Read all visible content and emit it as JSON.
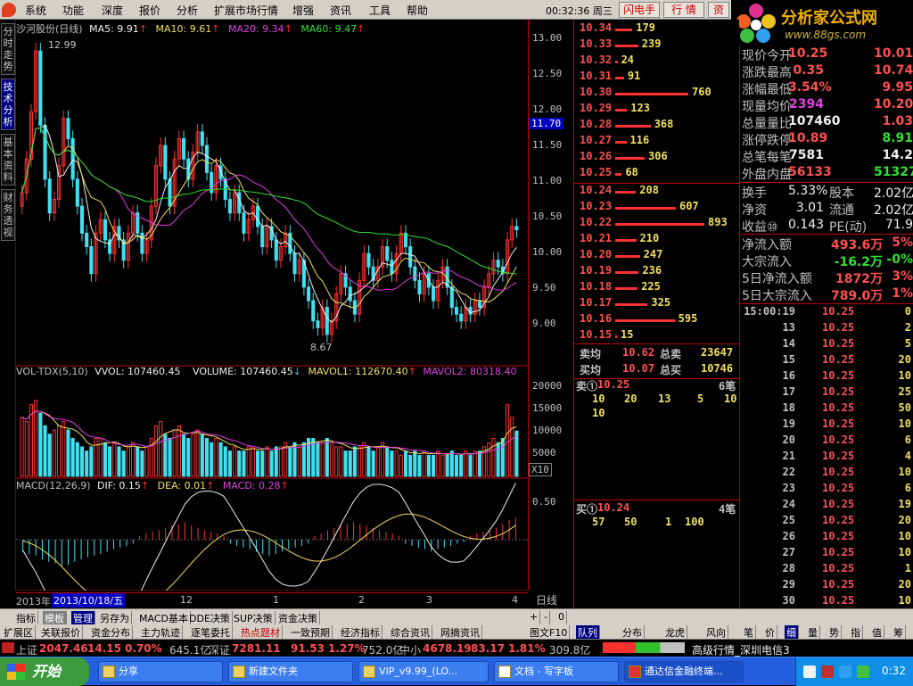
{
  "menu": {
    "items": [
      "系统",
      "功能",
      "深度",
      "报价",
      "分析",
      "扩展市场行情",
      "增强",
      "资讯",
      "工具",
      "帮助"
    ],
    "clock": "00:32:36 周三",
    "buttons": [
      "闪电手",
      "行 情",
      "资"
    ]
  },
  "brand": {
    "title": "分析家公式网",
    "url": "www.88gs.com"
  },
  "left_tabs": [
    "分时走势",
    "技术分析",
    "基本资料",
    "财务透视"
  ],
  "chart": {
    "header": {
      "name": "沙河股份(日线)",
      "ma5": "MA5: 9.91",
      "ma10": "MA10: 9.61",
      "ma20": "MA20: 9.34",
      "ma60": "MA60: 9.47"
    },
    "price_axis": [
      "13.00",
      "12.50",
      "12.00",
      "11.50",
      "11.00",
      "10.50",
      "10.00",
      "9.50",
      "9.00"
    ],
    "price_tag": "11.70",
    "high_label": "12.99",
    "low_label": "8.67",
    "vol_header": {
      "name": "VOL-TDX(5,10)",
      "vvol": "VVOL: 107460.45",
      "volume": "VOLUME: 107460.45",
      "mavol1": "MAVOL1: 112670.40",
      "mavol2": "MAVOL2: 80318.40"
    },
    "vol_axis": [
      "20000",
      "15000",
      "10000",
      "5000"
    ],
    "vol_unit": "X10",
    "macd_header": {
      "name": "MACD(12,26,9)",
      "dif": "DIF: 0.15",
      "dea": "DEA: 0.01",
      "macd": "MACD: 0.28"
    },
    "macd_axis": [
      "0.50"
    ],
    "date_axis": {
      "year": "2013年",
      "date": "2013/10/18/五",
      "ticks": [
        "12",
        "1",
        "2",
        "3",
        "4"
      ]
    },
    "period": "日线",
    "chart_data": {
      "type": "candlestick",
      "price_ylim": [
        8.5,
        13.1
      ],
      "macd_ylim": [
        -0.6,
        0.6
      ],
      "closes": [
        10.8,
        11.3,
        12.0,
        12.9,
        11.8,
        11.0,
        10.5,
        10.7,
        11.2,
        11.9,
        11.6,
        11.0,
        10.6,
        10.2,
        10.0,
        9.6,
        10.2,
        10.4,
        10.1,
        9.9,
        10.3,
        10.1,
        9.8,
        10.2,
        10.5,
        10.2,
        9.9,
        10.1,
        10.6,
        11.2,
        11.5,
        11.0,
        10.6,
        11.3,
        11.6,
        11.3,
        11.0,
        11.4,
        11.7,
        11.5,
        11.1,
        10.8,
        11.2,
        11.0,
        10.7,
        10.5,
        10.8,
        10.5,
        10.2,
        10.4,
        10.6,
        10.3,
        10.0,
        10.3,
        10.1,
        9.8,
        10.0,
        10.2,
        9.9,
        9.6,
        9.8,
        9.4,
        9.2,
        8.9,
        8.8,
        9.1,
        8.7,
        8.9,
        9.3,
        9.6,
        9.4,
        9.2,
        9.0,
        9.5,
        9.9,
        9.7,
        9.5,
        9.7,
        10.0,
        9.8,
        9.6,
        9.9,
        10.2,
        10.0,
        9.7,
        9.5,
        9.3,
        9.6,
        9.4,
        9.2,
        9.5,
        9.7,
        9.4,
        9.1,
        9.0,
        8.9,
        9.1,
        9.0,
        9.2,
        9.1,
        9.4,
        9.6,
        9.8,
        9.7,
        9.6,
        10.1,
        10.3,
        10.25
      ],
      "volumes": [
        14000,
        13000,
        17000,
        18000,
        15000,
        12000,
        10000,
        11000,
        12000,
        13000,
        11000,
        9000,
        8000,
        7000,
        6000,
        7000,
        9000,
        9000,
        8000,
        7000,
        8000,
        7000,
        6000,
        7000,
        8000,
        7000,
        6000,
        7000,
        9000,
        12000,
        13000,
        10000,
        9000,
        11000,
        12000,
        10000,
        9000,
        10000,
        11000,
        10000,
        9000,
        8000,
        9000,
        8000,
        7000,
        6000,
        7000,
        6000,
        6000,
        7000,
        7000,
        6000,
        6000,
        7000,
        6000,
        7000,
        7000,
        8000,
        7000,
        8000,
        7000,
        8000,
        9000,
        9000,
        8000,
        8000,
        9000,
        8000,
        7000,
        7000,
        6000,
        6000,
        7000,
        7000,
        8000,
        7000,
        6000,
        7000,
        8000,
        7000,
        6000,
        6000,
        5000,
        6000,
        5000,
        6000,
        5000,
        6000,
        5000,
        5000,
        6000,
        5000,
        5000,
        6000,
        5000,
        5000,
        6000,
        5000,
        6000,
        6000,
        7000,
        8000,
        9000,
        8000,
        9000,
        17000,
        14000,
        10746
      ],
      "macd_hist": [
        -0.15,
        -0.18,
        -0.2,
        -0.25,
        -0.28,
        -0.3,
        -0.35,
        -0.32,
        -0.28,
        -0.25,
        -0.22,
        -0.2,
        -0.18,
        -0.15,
        -0.12,
        -0.1,
        -0.08,
        -0.05,
        0.05,
        0.08,
        0.1,
        0.12,
        0.15,
        0.18,
        0.2,
        0.22,
        0.18,
        0.15,
        0.12,
        0.1,
        0.08,
        0.05,
        -0.05,
        -0.08,
        -0.1,
        -0.12,
        -0.15,
        -0.18,
        -0.2,
        -0.18,
        -0.15,
        -0.12,
        -0.1,
        -0.08,
        -0.05,
        0.05,
        0.08,
        0.12,
        0.15,
        0.18,
        0.2,
        0.22,
        0.2,
        0.18,
        0.15,
        0.12,
        0.1,
        0.08,
        0.05,
        -0.05,
        -0.08,
        -0.1,
        -0.12,
        -0.15,
        -0.12,
        -0.1,
        -0.08,
        -0.05,
        -0.03,
        0.05,
        0.08,
        0.1,
        0.12,
        0.15,
        0.2,
        0.25,
        0.28
      ]
    }
  },
  "orderbook": {
    "asks": [
      {
        "p": "10.34",
        "v": "179"
      },
      {
        "p": "10.33",
        "v": "239"
      },
      {
        "p": "10.32",
        "v": "24"
      },
      {
        "p": "10.31",
        "v": "91"
      },
      {
        "p": "10.30",
        "v": "760"
      },
      {
        "p": "10.29",
        "v": "123"
      },
      {
        "p": "10.28",
        "v": "368"
      },
      {
        "p": "10.27",
        "v": "116"
      },
      {
        "p": "10.26",
        "v": "306"
      },
      {
        "p": "10.25",
        "v": "68"
      }
    ],
    "bids": [
      {
        "p": "10.24",
        "v": "208"
      },
      {
        "p": "10.23",
        "v": "607"
      },
      {
        "p": "10.22",
        "v": "893"
      },
      {
        "p": "10.21",
        "v": "210"
      },
      {
        "p": "10.20",
        "v": "247"
      },
      {
        "p": "10.19",
        "v": "236"
      },
      {
        "p": "10.18",
        "v": "225"
      },
      {
        "p": "10.17",
        "v": "325"
      },
      {
        "p": "10.16",
        "v": "595"
      },
      {
        "p": "10.15",
        "v": "15"
      }
    ],
    "sell_avg_label": "卖均",
    "sell_avg": "10.62",
    "total_sell_label": "总卖",
    "total_sell": "23647",
    "buy_avg_label": "买均",
    "buy_avg": "10.07",
    "total_buy_label": "总买",
    "total_buy": "10746",
    "sell1_label": "卖①",
    "sell1_price": "10.25",
    "sell1_count": "6笔",
    "sell1_queue": [
      "10",
      "20",
      "13",
      "5",
      "10",
      "10"
    ],
    "buy1_label": "买①",
    "buy1_price": "10.24",
    "buy1_count": "4笔",
    "buy1_queue": [
      "57",
      "50",
      "1",
      "100"
    ]
  },
  "quote": {
    "rows": [
      {
        "l1": "现价",
        "v1": "10.25",
        "l2": "今开",
        "v2": "10.01",
        "c1": "#ff5050",
        "c2": "#ff5050"
      },
      {
        "l1": "涨跌",
        "v1": "0.35",
        "l2": "最高",
        "v2": "10.74",
        "c1": "#ff5050",
        "c2": "#ff5050"
      },
      {
        "l1": "涨幅",
        "v1": "3.54%",
        "l2": "最低",
        "v2": "9.95",
        "c1": "#ff5050",
        "c2": "#ff5050"
      },
      {
        "l1": "现量",
        "v1": "2394",
        "l2": "均价",
        "v2": "10.20",
        "c1": "#e040e0",
        "c2": "#ff5050"
      },
      {
        "l1": "总量",
        "v1": "107460",
        "l2": "量比",
        "v2": "1.03",
        "c1": "#f0f0f0",
        "c2": "#ff5050"
      },
      {
        "l1": "涨停",
        "v1": "10.89",
        "l2": "跌停",
        "v2": "8.91",
        "c1": "#ff5050",
        "c2": "#30e030"
      },
      {
        "l1": "总笔",
        "v1": "7581",
        "l2": "每笔",
        "v2": "14.2",
        "c1": "#f0f0f0",
        "c2": "#f0f0f0"
      },
      {
        "l1": "外盘",
        "v1": "56133",
        "l2": "内盘",
        "v2": "51327",
        "c1": "#ff5050",
        "c2": "#30e030"
      }
    ],
    "rows2": [
      {
        "l1": "换手",
        "v1": "5.33%",
        "l2": "股本",
        "v2": "2.02亿"
      },
      {
        "l1": "净资",
        "v1": "3.01",
        "l2": "流通",
        "v2": "2.02亿"
      },
      {
        "l1": "收益⑩",
        "v1": "0.143",
        "l2": "PE(动)",
        "v2": "71.9"
      }
    ],
    "flows": [
      {
        "l": "净流入额",
        "v": "493.6万",
        "p": "5%",
        "c": "#ff5050"
      },
      {
        "l": "大宗流入",
        "v": "-16.2万",
        "p": "-0%",
        "c": "#30e030"
      },
      {
        "l": "5日净流入额",
        "v": "1872万",
        "p": "3%",
        "c": "#ff5050"
      },
      {
        "l": "5日大宗流入",
        "v": "789.0万",
        "p": "1%",
        "c": "#ff5050"
      }
    ],
    "trades": [
      {
        "t": "15:00:19",
        "p": "10.25",
        "v": "0"
      },
      {
        "t": "13",
        "p": "10.25",
        "v": "2"
      },
      {
        "t": "14",
        "p": "10.25",
        "v": "5"
      },
      {
        "t": "15",
        "p": "10.25",
        "v": "20"
      },
      {
        "t": "16",
        "p": "10.25",
        "v": "10"
      },
      {
        "t": "17",
        "p": "10.25",
        "v": "25"
      },
      {
        "t": "18",
        "p": "10.25",
        "v": "50"
      },
      {
        "t": "19",
        "p": "10.25",
        "v": "10"
      },
      {
        "t": "20",
        "p": "10.25",
        "v": "6"
      },
      {
        "t": "21",
        "p": "10.25",
        "v": "4"
      },
      {
        "t": "22",
        "p": "10.25",
        "v": "10"
      },
      {
        "t": "23",
        "p": "10.25",
        "v": "6"
      },
      {
        "t": "24",
        "p": "10.25",
        "v": "19"
      },
      {
        "t": "25",
        "p": "10.25",
        "v": "20"
      },
      {
        "t": "26",
        "p": "10.25",
        "v": "10"
      },
      {
        "t": "27",
        "p": "10.25",
        "v": "10"
      },
      {
        "t": "28",
        "p": "10.25",
        "v": "1"
      },
      {
        "t": "29",
        "p": "10.25",
        "v": "20"
      },
      {
        "t": "30",
        "p": "10.25",
        "v": "10"
      }
    ]
  },
  "bottom": {
    "tabs1": [
      "指标",
      "模板",
      "管理",
      "另存为",
      "MACD基本",
      "DDE决策",
      "SUP决策",
      "资金决策"
    ],
    "tabs2": [
      "扩展区",
      "关联报价",
      "资金分布",
      "主力轨迹",
      "逐笔委托",
      "热点题材",
      "一致预期",
      "经济指标",
      "综合资讯",
      "网摘资讯"
    ],
    "right1": [
      "+",
      "-",
      "0"
    ],
    "right2": "图文F10",
    "queue_tabs": [
      "队列",
      "分布",
      "龙虎",
      "风向"
    ],
    "detail_tabs": [
      "笔",
      "价",
      "细",
      "量",
      "势",
      "指",
      "值",
      "筹"
    ]
  },
  "index": {
    "sh_label": "上证",
    "sh": "2047.46",
    "sh_chg": "14.15",
    "sh_pct": "0.70%",
    "sh_amt": "645.1亿",
    "sz_label": "深证",
    "sz": "7281.11",
    "sz_chg": "91.53",
    "sz_pct": "1.27%",
    "sz_amt": "752.0亿",
    "zx_label": "中小",
    "zx": "4678.19",
    "zx_chg": "83.17",
    "zx_pct": "1.81%",
    "zx_amt": "309.8亿",
    "status": "高级行情_深圳电信3"
  },
  "taskbar": {
    "start": "开始",
    "tasks": [
      "分享",
      "新建文件夹",
      "VIP_v9.99_(LO...",
      "文档 - 写字板",
      "通达信金融终端..."
    ],
    "time": "0:32"
  }
}
